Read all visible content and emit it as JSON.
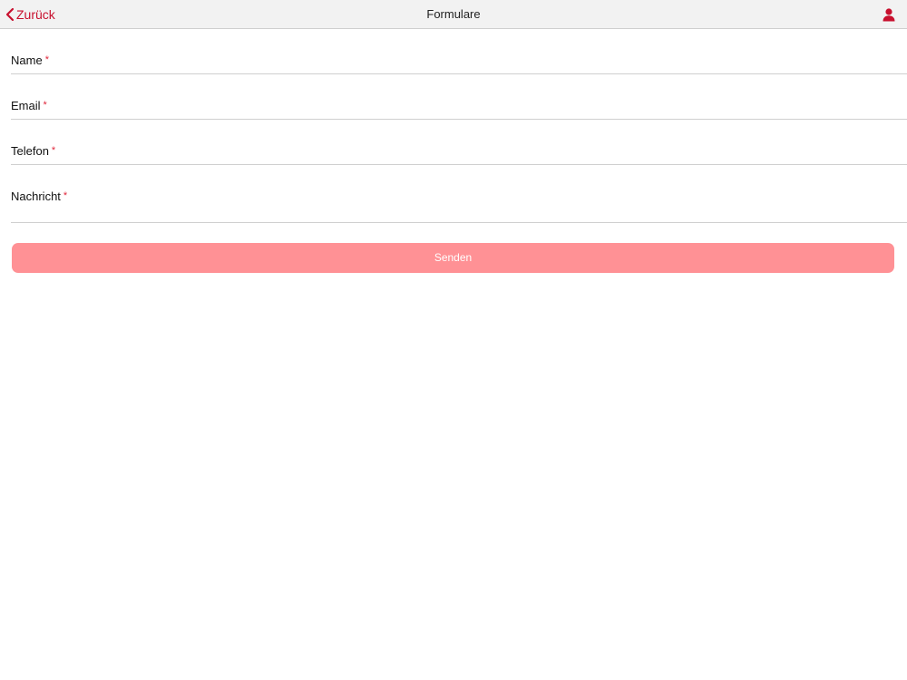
{
  "navbar": {
    "back_label": "Zurück",
    "title": "Formulare",
    "user_icon": "user-icon"
  },
  "form": {
    "fields": [
      {
        "label": "Name",
        "required_mark": "*",
        "value": ""
      },
      {
        "label": "Email",
        "required_mark": "*",
        "value": ""
      },
      {
        "label": "Telefon",
        "required_mark": "*",
        "value": ""
      },
      {
        "label": "Nachricht",
        "required_mark": "*",
        "value": ""
      }
    ],
    "submit_label": "Senden"
  },
  "colors": {
    "accent": "#c8102e",
    "button": "#ff9195",
    "navbar_bg": "#f2f2f2"
  }
}
